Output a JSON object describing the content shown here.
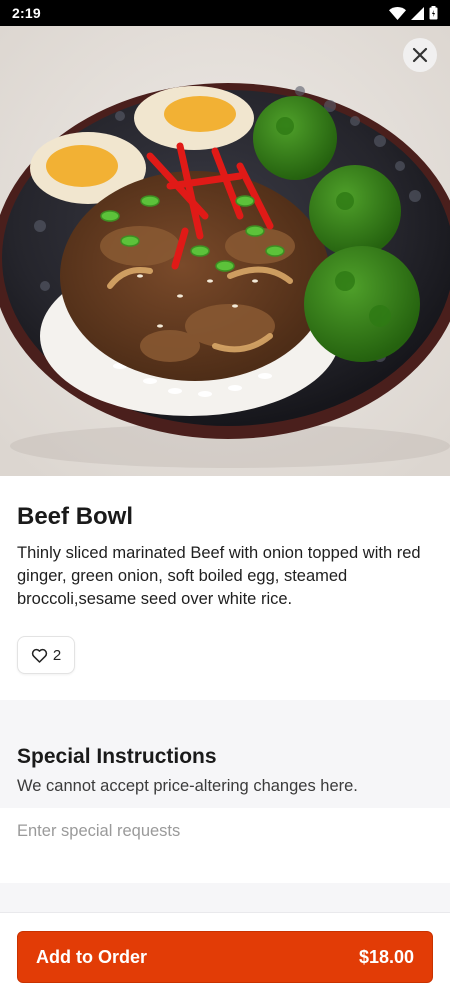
{
  "status_bar": {
    "time": "2:19"
  },
  "item": {
    "title": "Beef Bowl",
    "description": "Thinly sliced marinated Beef with onion topped with red ginger, green onion, soft boiled egg, steamed broccoli,sesame seed over white rice.",
    "likes": "2"
  },
  "special_instructions": {
    "title": "Special Instructions",
    "subtitle": "We cannot accept price-altering changes here.",
    "placeholder": "Enter special requests"
  },
  "order_button": {
    "label": "Add to Order",
    "price": "$18.00"
  },
  "colors": {
    "accent": "#e23c06",
    "section_bg": "#f6f6f8"
  },
  "icons": [
    "wifi-icon",
    "signal-icon",
    "battery-icon",
    "close-icon",
    "heart-icon"
  ]
}
